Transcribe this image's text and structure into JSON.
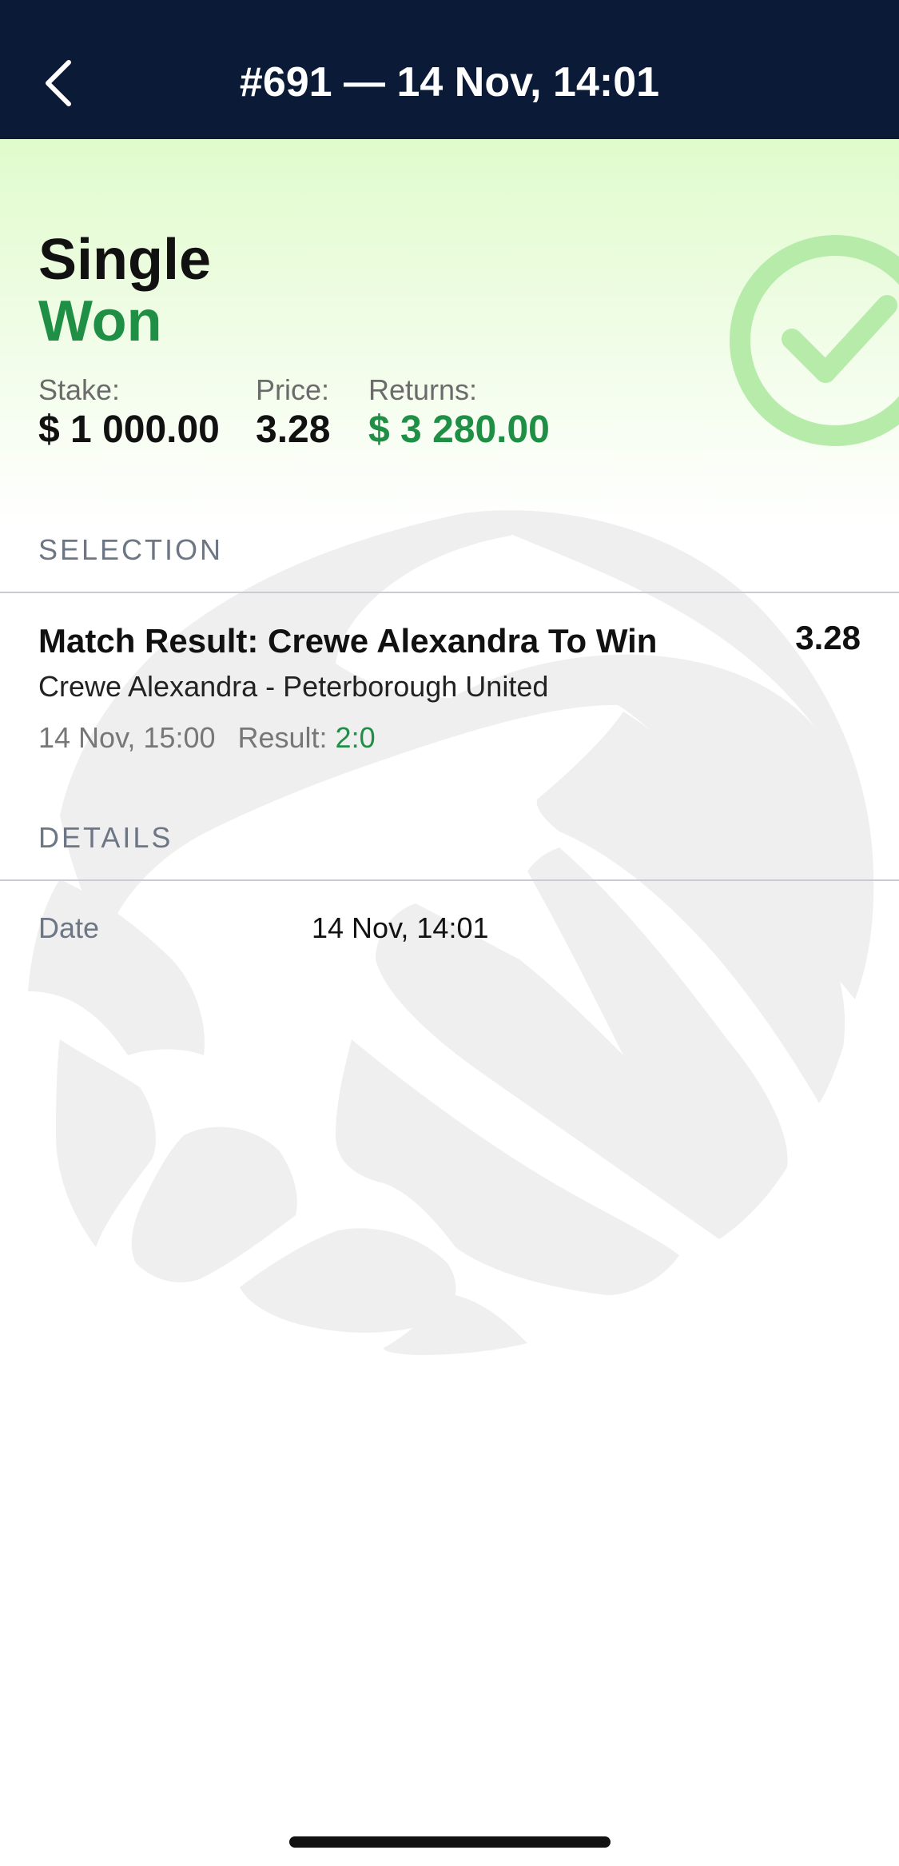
{
  "header": {
    "title": "#691 — 14 Nov, 14:01",
    "back_icon": "chevron-left-icon"
  },
  "summary": {
    "bet_type": "Single",
    "status": "Won",
    "status_icon": "checkmark-circle-icon",
    "stake_label": "Stake:",
    "stake_value": "$ 1 000.00",
    "price_label": "Price:",
    "price_value": "3.28",
    "returns_label": "Returns:",
    "returns_value": "$ 3 280.00"
  },
  "selection": {
    "heading": "SELECTION",
    "market": "Match Result: Crewe Alexandra To Win",
    "odds": "3.28",
    "event": "Crewe Alexandra - Peterborough United",
    "datetime": "14 Nov, 15:00",
    "result_label": "Result:",
    "result_value": "2:0"
  },
  "details": {
    "heading": "DETAILS",
    "rows": [
      {
        "label": "Date",
        "value": "14 Nov, 14:01"
      }
    ]
  },
  "colors": {
    "navbar": "#0b1a36",
    "win_green": "#1f8f45",
    "hero_top": "#e0fbcc",
    "watermark": "#efefef"
  },
  "watermark_icon": "ball-logo-icon"
}
